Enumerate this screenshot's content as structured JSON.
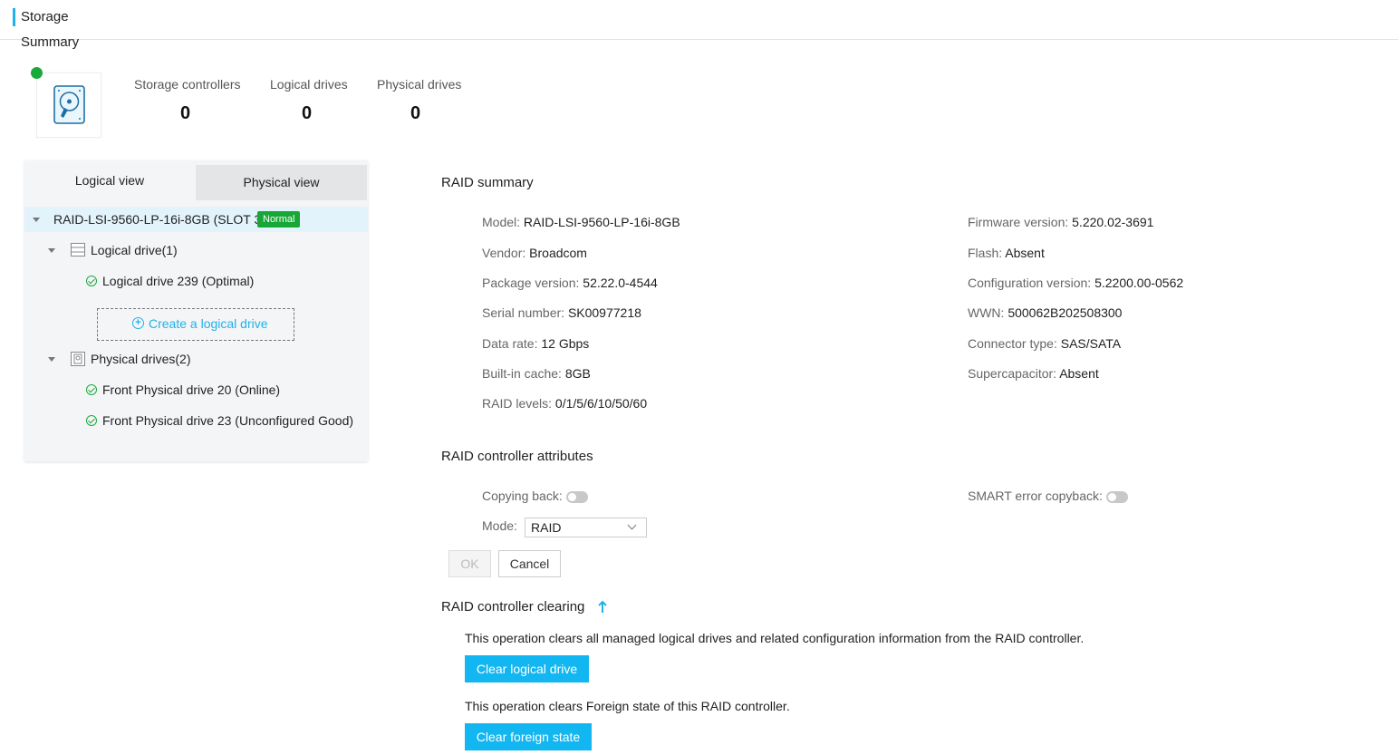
{
  "header": {
    "title": "Storage",
    "summary": "Summary"
  },
  "stats": [
    {
      "label": "Storage controllers",
      "value": "0"
    },
    {
      "label": "Logical drives",
      "value": "0"
    },
    {
      "label": "Physical drives",
      "value": "0"
    }
  ],
  "tabs": {
    "logical": "Logical view",
    "physical": "Physical view"
  },
  "tree": {
    "controller": "RAID-LSI-9560-LP-16i-8GB (SLOT 3)",
    "controller_status": "Normal",
    "logical_group": "Logical drive(1)",
    "logical_item": "Logical drive 239 (Optimal)",
    "create_label": "Create a logical drive",
    "physical_group": "Physical drives(2)",
    "physical_items": [
      "Front Physical drive 20 (Online)",
      "Front Physical drive 23 (Unconfigured Good)"
    ]
  },
  "raid_summary": {
    "title": "RAID summary",
    "left": [
      {
        "k": "Model:",
        "v": "RAID-LSI-9560-LP-16i-8GB"
      },
      {
        "k": "Vendor:",
        "v": "Broadcom"
      },
      {
        "k": "Package version:",
        "v": "52.22.0-4544"
      },
      {
        "k": "Serial number:",
        "v": "SK00977218"
      },
      {
        "k": "Data rate:",
        "v": "12 Gbps"
      },
      {
        "k": "Built-in cache:",
        "v": "8GB"
      },
      {
        "k": "RAID levels:",
        "v": "0/1/5/6/10/50/60"
      }
    ],
    "right": [
      {
        "k": "Firmware version:",
        "v": "5.220.02-3691"
      },
      {
        "k": "Flash:",
        "v": "Absent"
      },
      {
        "k": "Configuration version:",
        "v": "5.2200.00-0562"
      },
      {
        "k": "WWN:",
        "v": "500062B202508300"
      },
      {
        "k": "Connector type:",
        "v": "SAS/SATA"
      },
      {
        "k": "Supercapacitor:",
        "v": "Absent"
      }
    ]
  },
  "attributes": {
    "title": "RAID controller attributes",
    "copying_back": "Copying back:",
    "copying_back_on": false,
    "smart_copyback": "SMART error copyback:",
    "smart_copyback_on": false,
    "mode_label": "Mode:",
    "mode_value": "RAID",
    "ok": "OK",
    "cancel": "Cancel"
  },
  "clearing": {
    "title": "RAID controller clearing",
    "desc1": "This operation clears all managed logical drives and related configuration information from the RAID controller.",
    "btn1": "Clear logical drive",
    "desc2": "This operation clears Foreign state of this RAID controller.",
    "btn2": "Clear foreign state"
  },
  "colors": {
    "accent": "#1fb2ea",
    "ok_green": "#1aaa3b",
    "button_blue": "#12b6f0"
  }
}
